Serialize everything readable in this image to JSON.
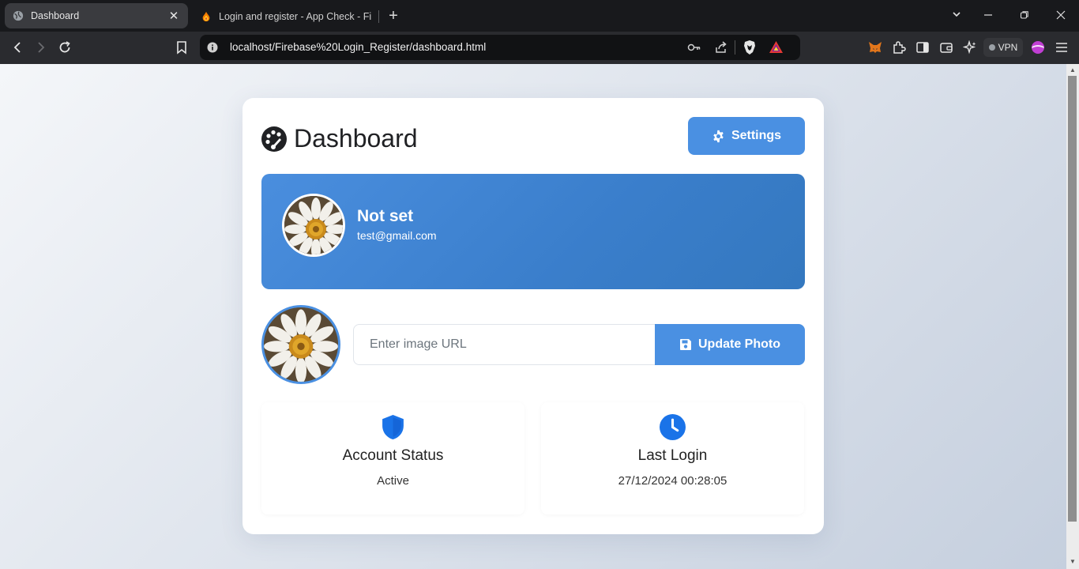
{
  "browser": {
    "tabs": [
      {
        "title": "Dashboard",
        "active": true
      },
      {
        "title": "Login and register - App Check - Fir",
        "active": false
      }
    ],
    "url": "localhost/Firebase%20Login_Register/dashboard.html",
    "vpn_label": "VPN"
  },
  "page": {
    "title": "Dashboard",
    "settings_label": "Settings",
    "profile": {
      "name": "Not set",
      "email": "test@gmail.com"
    },
    "photo": {
      "input_placeholder": "Enter image URL",
      "update_label": "Update Photo"
    },
    "stats": [
      {
        "label": "Account Status",
        "value": "Active",
        "icon": "shield-icon"
      },
      {
        "label": "Last Login",
        "value": "27/12/2024 00:28:05",
        "icon": "clock-icon"
      }
    ]
  },
  "colors": {
    "accent": "#4a90e2",
    "banner_start": "#4a8ede",
    "banner_end": "#3478bf",
    "icon_blue": "#1a73e8"
  }
}
